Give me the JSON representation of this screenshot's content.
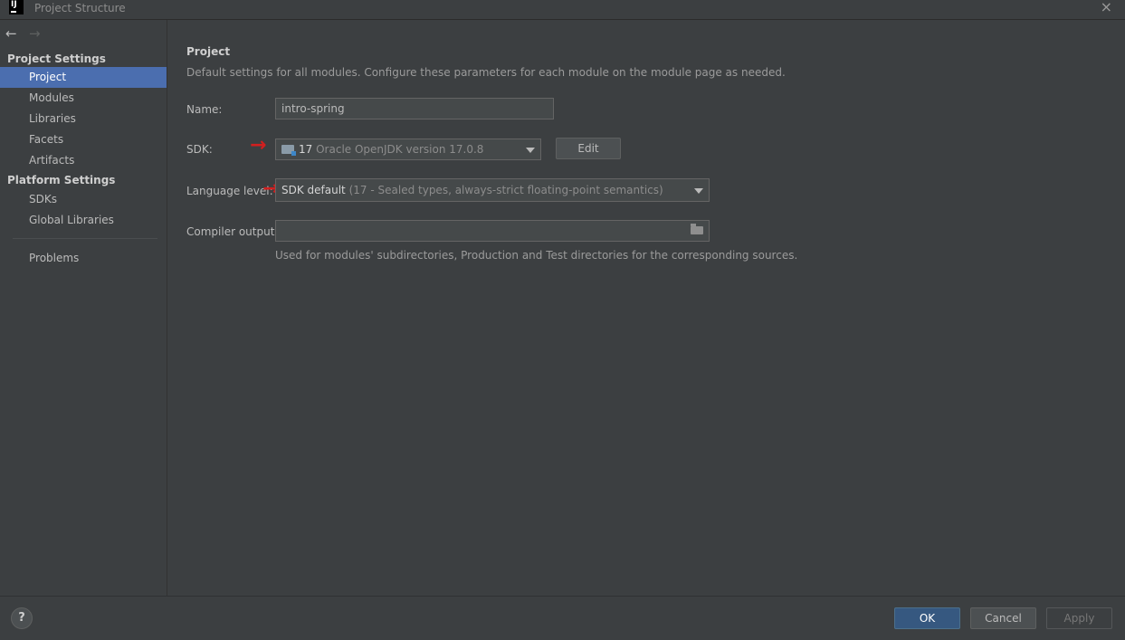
{
  "window": {
    "title": "Project Structure",
    "logo_text": "IJ"
  },
  "nav": {
    "back": "←",
    "forward": "→"
  },
  "sidebar": {
    "project_settings_heading": "Project Settings",
    "project_items": [
      "Project",
      "Modules",
      "Libraries",
      "Facets",
      "Artifacts"
    ],
    "platform_settings_heading": "Platform Settings",
    "platform_items": [
      "SDKs",
      "Global Libraries"
    ],
    "problems": "Problems",
    "selected": "Project"
  },
  "main": {
    "heading": "Project",
    "description": "Default settings for all modules. Configure these parameters for each module on the module page as needed.",
    "name": {
      "label": "Name:",
      "value": "intro-spring"
    },
    "sdk": {
      "label": "SDK:",
      "version_num": "17",
      "version_text": "Oracle OpenJDK version 17.0.8",
      "edit_label": "Edit"
    },
    "language_level": {
      "label": "Language level:",
      "value": "SDK default",
      "detail": "(17 - Sealed types, always-strict floating-point semantics)"
    },
    "compiler_output": {
      "label": "Compiler output:",
      "value": "",
      "hint": "Used for modules' subdirectories, Production and Test directories for the corresponding sources."
    }
  },
  "annotations": {
    "arrow_glyph": "→",
    "arrow_color": "#d11f1f"
  },
  "footer": {
    "help": "?",
    "ok": "OK",
    "cancel": "Cancel",
    "apply": "Apply"
  },
  "colors": {
    "background": "#3c3f41",
    "selection": "#4b6eaf",
    "primary_button": "#365880"
  }
}
